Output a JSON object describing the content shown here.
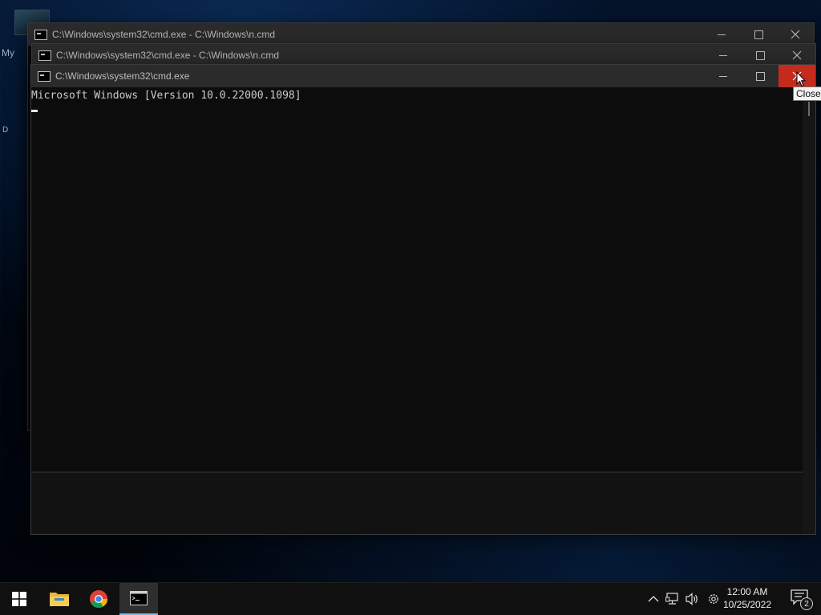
{
  "desktop": {
    "icon_labels": [
      "My",
      "D"
    ]
  },
  "windows": [
    {
      "title": "C:\\Windows\\system32\\cmd.exe - C:\\Windows\\n.cmd",
      "icon": "cmd-icon"
    },
    {
      "title": "C:\\Windows\\system32\\cmd.exe - C:\\Windows\\n.cmd",
      "icon": "cmd-icon"
    },
    {
      "title": "C:\\Windows\\system32\\cmd.exe",
      "icon": "cmd-icon",
      "console_line": "Microsoft Windows [Version 10.0.22000.1098]"
    }
  ],
  "tooltip": "Close",
  "taskbar": {
    "apps": [
      {
        "name": "start",
        "icon": "windows-logo-icon"
      },
      {
        "name": "file-explorer",
        "icon": "folder-icon"
      },
      {
        "name": "chrome",
        "icon": "chrome-icon"
      },
      {
        "name": "command-prompt",
        "icon": "cmd-icon",
        "active": true
      }
    ],
    "tray": {
      "icons": [
        "chevron-up-icon",
        "network-icon",
        "volume-icon",
        "gear-icon"
      ],
      "time": "12:00 AM",
      "date": "10/25/2022",
      "notification_count": "2"
    }
  },
  "colors": {
    "close_hover": "#c42b1c",
    "titlebar": "#2b2b2b",
    "console_bg": "#0c0c0c",
    "taskbar": "#101010",
    "accent": "#76b9ed"
  }
}
